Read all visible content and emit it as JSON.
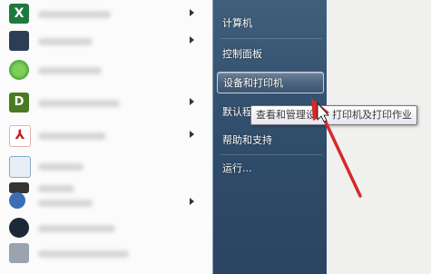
{
  "right_panel": {
    "top_item_partial": "",
    "items": [
      "计算机",
      "控制面板",
      "设备和打印机",
      "默认程序",
      "帮助和支持",
      "运行..."
    ],
    "highlighted_index": 2
  },
  "tooltip": {
    "part1": "查看和管理设",
    "part2": "打印机及打印作业"
  },
  "left_panel": {
    "program_icons": [
      "excel-icon",
      "generic-icon",
      "clover-icon",
      "dreamweaver-icon",
      "acrobat-icon",
      "document-icon",
      "device-icon",
      "network-icon",
      "app-icon",
      "app-icon"
    ]
  },
  "colors": {
    "panel_blue": "#2f4c6a",
    "highlight": "#4d6580",
    "arrow_red": "#d42a2a"
  }
}
